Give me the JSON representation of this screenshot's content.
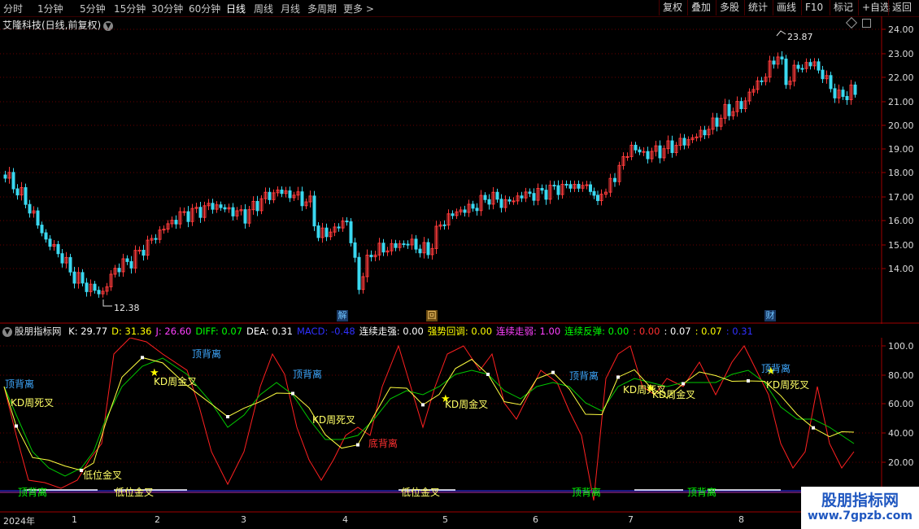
{
  "toolbar": {
    "timeframes": [
      "分时",
      "1分钟",
      "5分钟",
      "15分钟",
      "30分钟",
      "60分钟",
      "日线",
      "周线",
      "月线",
      "多周期",
      "更多"
    ],
    "more_arrow": ">",
    "right_buttons": [
      "复权",
      "叠加",
      "多股",
      "统计",
      "画线",
      "F10",
      "标记",
      "+自选",
      "返回"
    ]
  },
  "main_chart": {
    "title": "艾隆科技(日线,前复权)",
    "high_label": "23.87",
    "low_label": "12.38",
    "y_ticks": [
      "24.00",
      "23.00",
      "22.00",
      "21.00",
      "20.00",
      "19.00",
      "18.00",
      "17.00",
      "16.00",
      "15.00",
      "14.00"
    ],
    "event_markers": [
      {
        "text": "解",
        "color": "#3fa9ff"
      },
      {
        "text": "回",
        "color": "#ffb040"
      },
      {
        "text": "财",
        "color": "#3fa9ff"
      }
    ]
  },
  "indicator": {
    "name": "股朋指标网",
    "values": [
      {
        "label": "K: 29.77",
        "color": "#ffffff"
      },
      {
        "label": "D: 31.36",
        "color": "#ffff00"
      },
      {
        "label": "J: 26.60",
        "color": "#ff40ff"
      },
      {
        "label": "DIFF: 0.07",
        "color": "#00ff00"
      },
      {
        "label": "DEA: 0.31",
        "color": "#ffffff"
      },
      {
        "label": "MACD: -0.48",
        "color": "#3030ff"
      },
      {
        "label": "连续走强: 0.00",
        "color": "#ffffff"
      },
      {
        "label": "强势回调: 0.00",
        "color": "#ffff00"
      },
      {
        "label": "连续走弱: 1.00",
        "color": "#ff40ff"
      },
      {
        "label": "连续反弹: 0.00",
        "color": "#00ff00"
      },
      {
        "label": ": 0.00",
        "color": "#ff3030"
      },
      {
        "label": ": 0.07",
        "color": "#ffffff"
      },
      {
        "label": ": 0.07",
        "color": "#ffff00"
      },
      {
        "label": ": 0.31",
        "color": "#3030ff"
      }
    ],
    "y_ticks": [
      "100.0",
      "80.00",
      "60.00",
      "40.00",
      "20.00"
    ],
    "annotations": [
      {
        "text": "顶背离",
        "color": "#3fa9ff"
      },
      {
        "text": "KD周死叉",
        "color": "#ffff66"
      },
      {
        "text": "KD周金叉",
        "color": "#ffff66"
      },
      {
        "text": "顶背离",
        "color": "#3fa9ff"
      },
      {
        "text": "顶背离",
        "color": "#3fa9ff"
      },
      {
        "text": "KD周死叉",
        "color": "#ffff66"
      },
      {
        "text": "底背离",
        "color": "#ff3030"
      },
      {
        "text": "KD周金叉",
        "color": "#ffff66"
      },
      {
        "text": "顶背离",
        "color": "#3fa9ff"
      },
      {
        "text": "KD周死叉",
        "color": "#ffff66"
      },
      {
        "text": "KD周金叉",
        "color": "#ffff66"
      },
      {
        "text": "顶背离",
        "color": "#3fa9ff"
      },
      {
        "text": "KD周死叉",
        "color": "#ffff66"
      },
      {
        "text": "低位金叉",
        "color": "#ffff66"
      },
      {
        "text": "顶背离",
        "color": "#00ff00"
      },
      {
        "text": "低位金叉",
        "color": "#ffff66"
      },
      {
        "text": "低位金叉",
        "color": "#ffff66"
      },
      {
        "text": "顶背离",
        "color": "#00ff00"
      },
      {
        "text": "顶背离",
        "color": "#00ff00"
      }
    ]
  },
  "time_axis": {
    "labels": [
      "2024年",
      "1",
      "2",
      "3",
      "4",
      "5",
      "6",
      "7",
      "8"
    ]
  },
  "watermark": {
    "title": "股朋指标网",
    "url": "www.7gpzb.com"
  }
}
